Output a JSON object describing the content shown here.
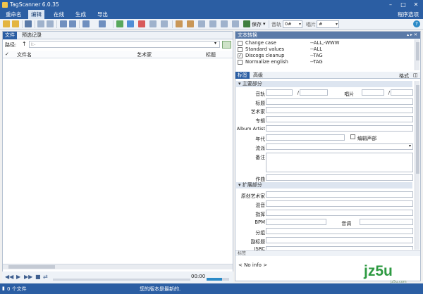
{
  "window": {
    "title": "TagScanner 6.0.35",
    "minimize": "–",
    "maximize": "□",
    "close": "✕"
  },
  "menu": {
    "items": [
      "重命名",
      "编辑",
      "在线",
      "生成",
      "导出"
    ],
    "active": 1,
    "right": "程序选项"
  },
  "toolbar": {
    "save_label": "保存",
    "track_label": "音轨",
    "track_value": "0#",
    "disc_label": "唱片",
    "disc_value": "#"
  },
  "left_panel": {
    "tabs": [
      "文件",
      "预选记录"
    ],
    "path_label": "路径:",
    "path_placeholder": "I:-",
    "columns": [
      "文件名",
      "艺术家",
      "标题"
    ]
  },
  "player": {
    "time": "00:00"
  },
  "status": {
    "files": "0 个文件",
    "message": "您的版本是最新的."
  },
  "convert_panel": {
    "title": "文本转换",
    "rows": [
      {
        "checked": false,
        "name": "Change case",
        "result": "--ALL,-WWW"
      },
      {
        "checked": false,
        "name": "Standard values",
        "result": "--ALL"
      },
      {
        "checked": true,
        "name": "Discogs cleanup",
        "result": "--TAG"
      },
      {
        "checked": false,
        "name": "Normalize english",
        "result": "--TAG"
      }
    ]
  },
  "tag_panel": {
    "tabs": [
      "标签",
      "高级"
    ],
    "format_label": "格式",
    "main_section": "主要部分",
    "fields": {
      "track": "音轨",
      "disc": "唱片",
      "title": "标题",
      "artist": "艺术家",
      "album": "专辑",
      "album_artist": "Album Artist",
      "year": "年代",
      "compilation": "编辑声部",
      "genre": "流派",
      "comment": "备注",
      "composer": "作曲"
    },
    "ext_section": "扩展部分",
    "ext_fields": {
      "orig_artist": "原创艺术家",
      "remix": "混音",
      "conductor": "指挥",
      "bpm": "BPM",
      "key": "音调",
      "grouping": "分组",
      "subtitle": "副标题",
      "isrc": "ISRC"
    },
    "footer_label": "标签",
    "no_info": "< No info >"
  },
  "watermark": {
    "text": "jz5u",
    "sub": "jz5u.com"
  },
  "colors": {
    "accent": "#2b5ea3",
    "panel_header": "#5a7aa8"
  },
  "icons": [
    "folder-icon",
    "save-icon",
    "undo-icon",
    "filter-icon",
    "play-icon",
    "stop-icon",
    "help-icon"
  ]
}
